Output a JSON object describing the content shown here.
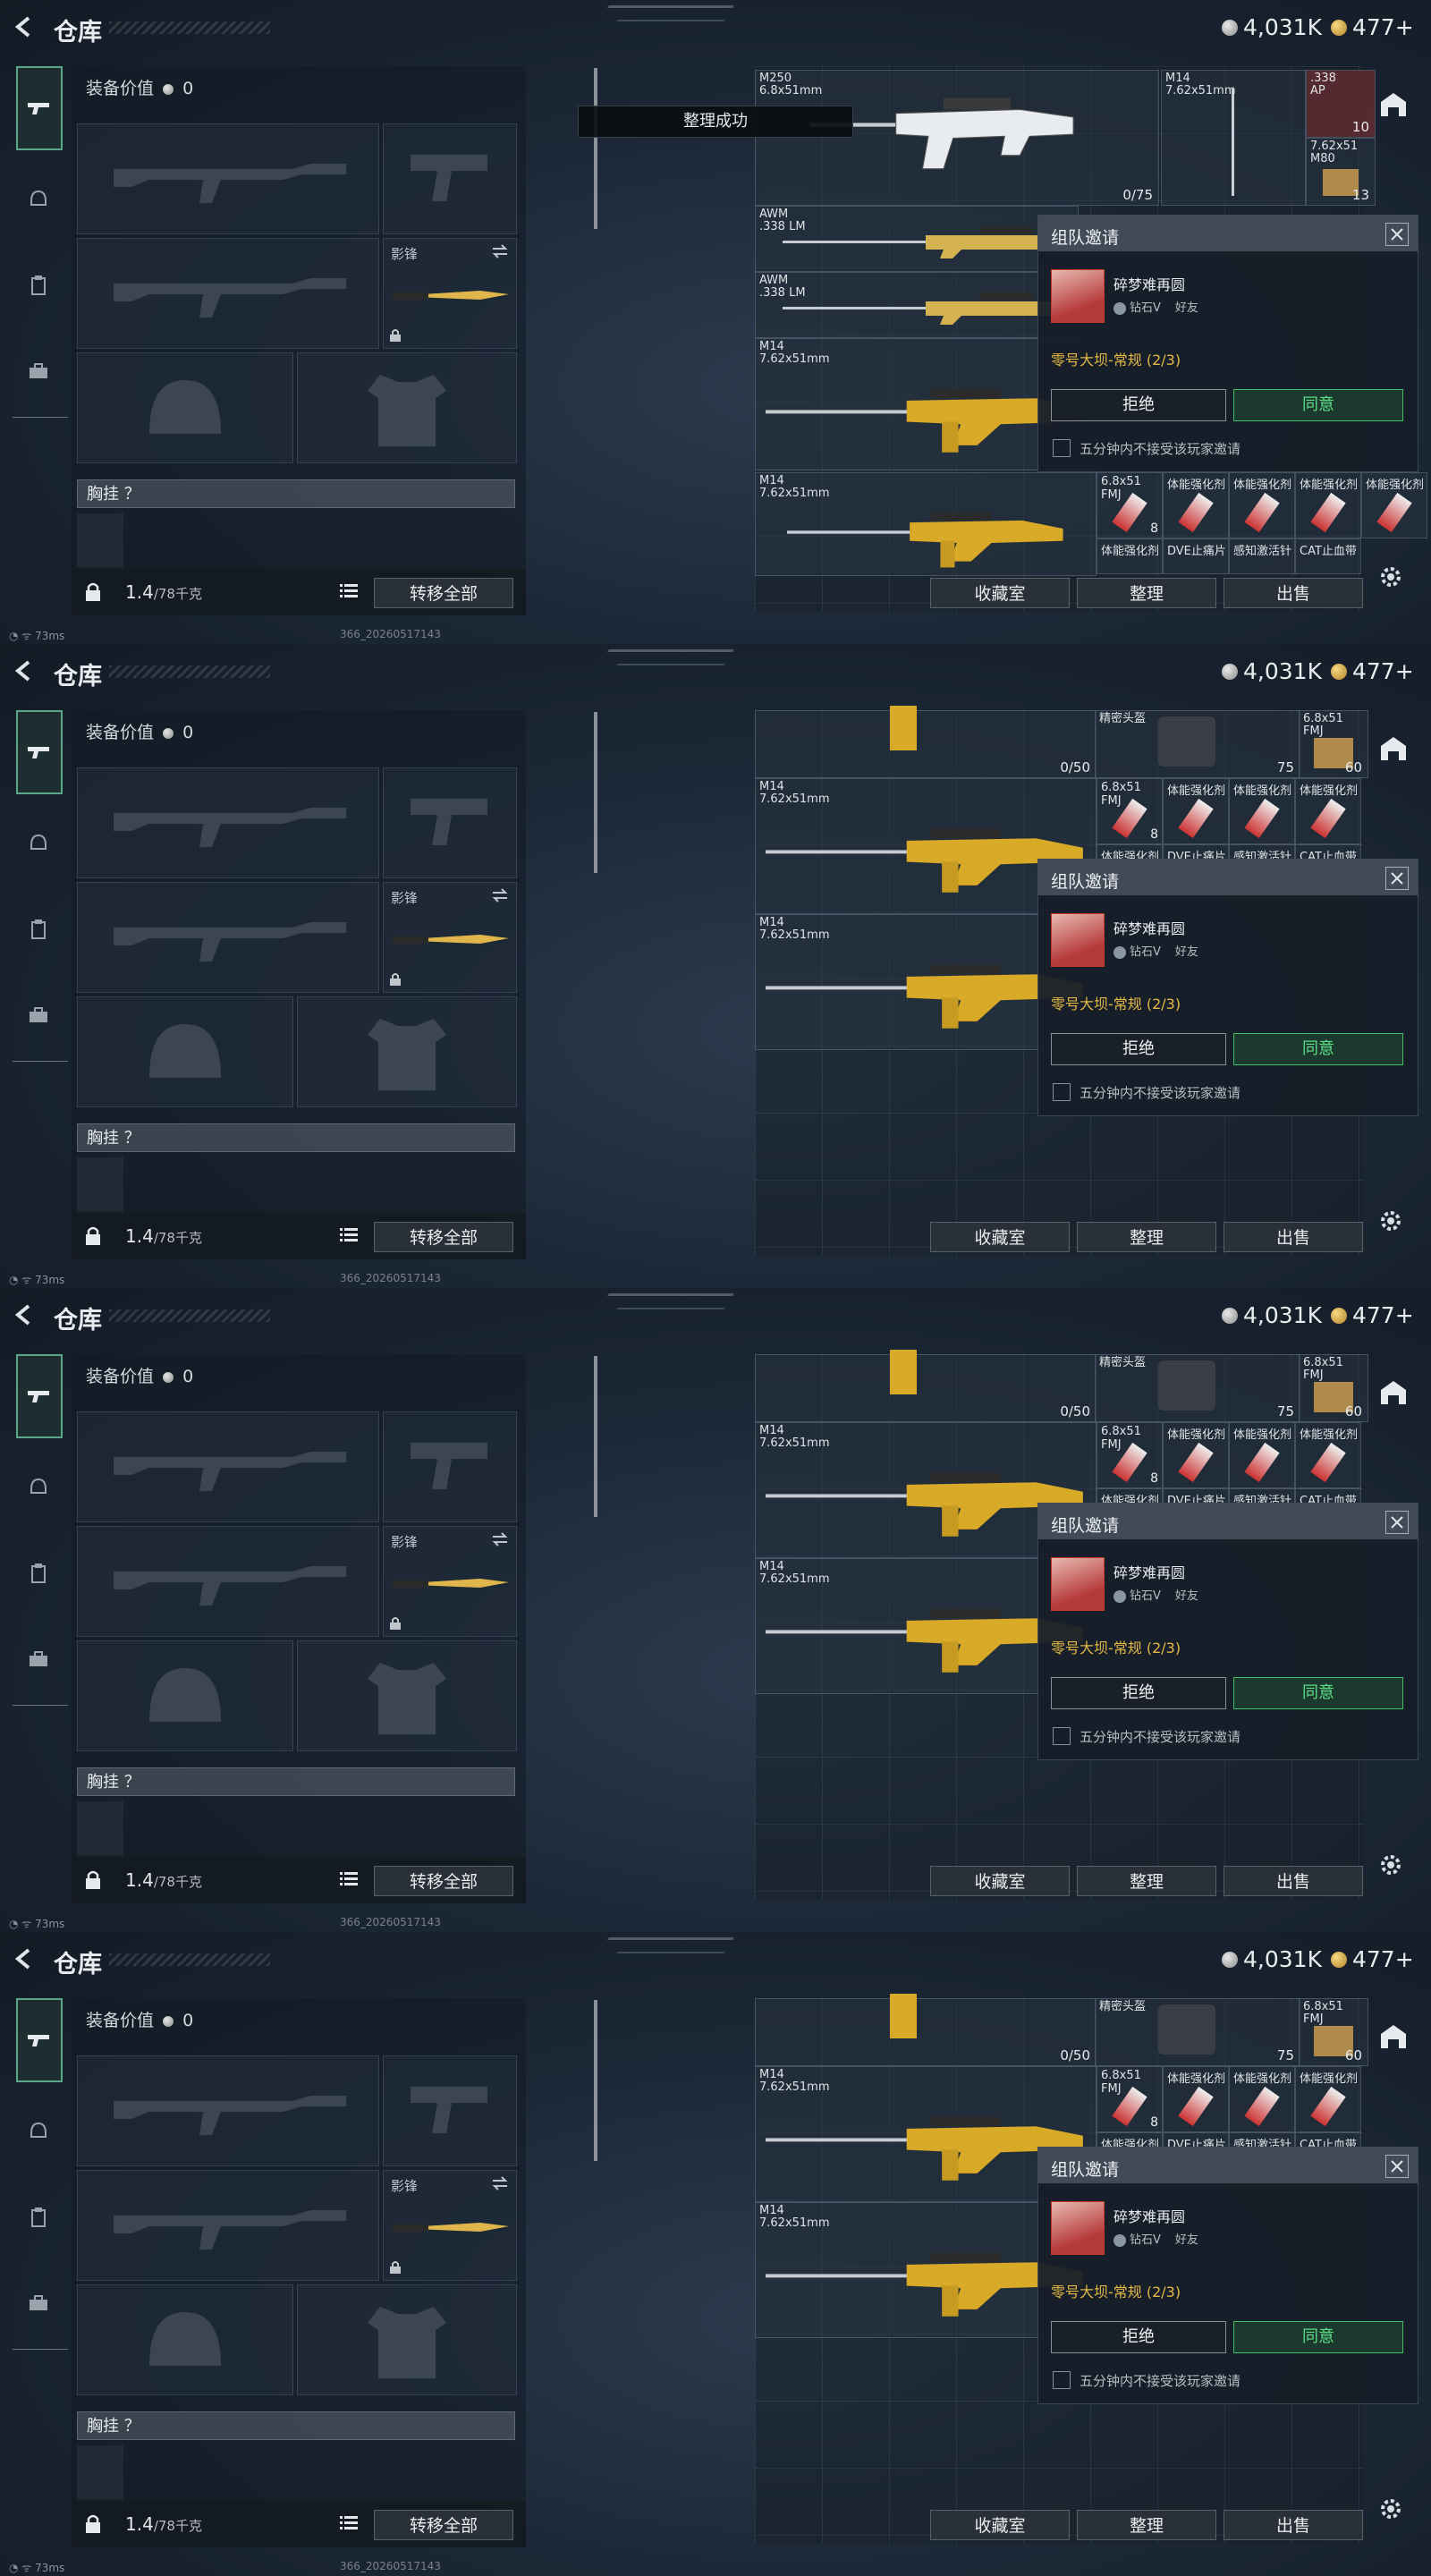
{
  "header": {
    "title": "仓库",
    "silver": "4,031K",
    "gold": "477+"
  },
  "left_panel": {
    "equip_value_label": "装备价值",
    "equip_value": "0",
    "melee_label": "影锋",
    "chest_label": "胸挂 ？",
    "weight": "1.4",
    "weight_max": "/78千克",
    "transfer_all": "转移全部"
  },
  "right_panel": {
    "collection_btn": "收藏室",
    "sort_btn": "整理",
    "sell_btn": "出售",
    "frame1_items": [
      {
        "name": "M250\n6.8x51mm",
        "count": "0/75"
      },
      {
        "name": "M14\n7.62x51mm",
        "count": ""
      },
      {
        "name": ".338\nAP",
        "count": "10"
      },
      {
        "name": "7.62x51\nM80",
        "count": "13"
      },
      {
        "name": "AWM\n.338 LM",
        "count": ""
      },
      {
        "name": "AWM\n.338 LM",
        "count": ""
      },
      {
        "name": "M14\n7.62x51mm",
        "count": ""
      },
      {
        "name": "M14\n7.62x51mm",
        "count": ""
      }
    ],
    "frame1_row": [
      {
        "name": "6.8x51\nFMJ",
        "count": "8"
      },
      {
        "name": "体能强化剂",
        "count": ""
      },
      {
        "name": "体能强化剂",
        "count": ""
      },
      {
        "name": "体能强化剂",
        "count": ""
      },
      {
        "name": "体能强化剂",
        "count": ""
      }
    ],
    "frame1_row_bottom": [
      "体能强化剂",
      "DVE止痛片",
      "感知激活针",
      "CAT止血带"
    ],
    "frame2_items": [
      {
        "name": "",
        "count": "0/50"
      },
      {
        "name": "精密头盔",
        "count": "75"
      },
      {
        "name": "6.8x51\nFMJ",
        "count": "60"
      },
      {
        "name": "M14\n7.62x51mm",
        "count": ""
      },
      {
        "name": "M14\n7.62x51mm",
        "count": ""
      }
    ],
    "frame2_row": [
      {
        "name": "6.8x51\nFMJ",
        "count": "8"
      },
      {
        "name": "体能强化剂",
        "count": ""
      },
      {
        "name": "体能强化剂",
        "count": ""
      },
      {
        "name": "体能强化剂",
        "count": ""
      }
    ],
    "frame2_row_bottom": [
      "体能强化剂",
      "DVE止痛片",
      "感知激活针",
      "CAT止血带"
    ]
  },
  "toast": "整理成功",
  "invite": {
    "title": "组队邀请",
    "username": "碎梦难再圆",
    "rank": "钻石V",
    "relation": "好友",
    "mode": "零号大坝-常规 (2/3)",
    "refuse": "拒绝",
    "accept": "同意",
    "mute_label": "五分钟内不接受该玩家邀请"
  },
  "status": {
    "ping": "73ms",
    "build": "366_20260517143"
  },
  "colors": {
    "accent_green": "#3fbf62",
    "mode_gold": "#e3b845"
  }
}
